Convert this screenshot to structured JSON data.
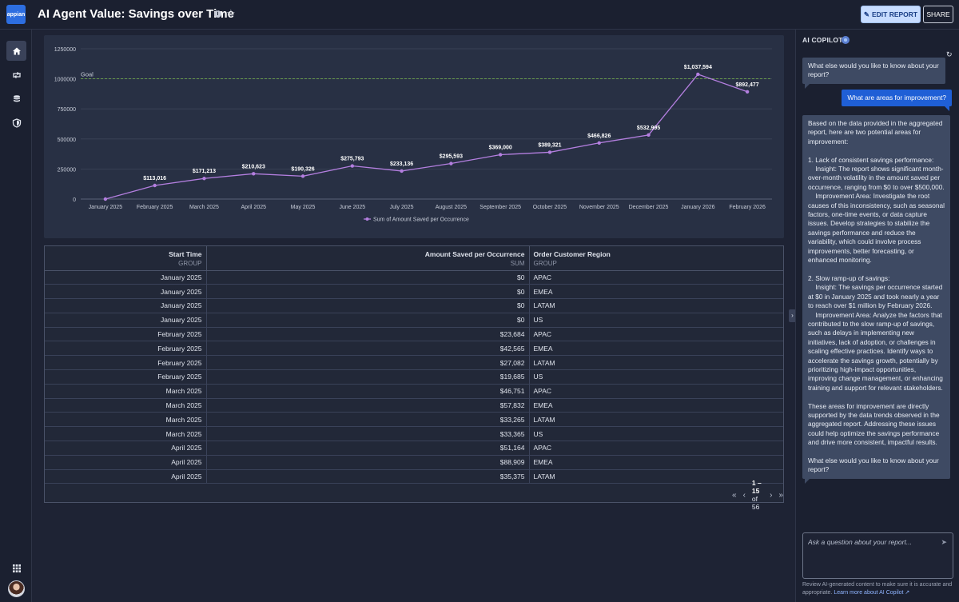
{
  "header": {
    "logo_text": "appian",
    "title": "AI Agent Value: Savings over Time",
    "edit_label": "EDIT REPORT",
    "share_label": "SHARE"
  },
  "nav": {
    "items": [
      "home-icon",
      "process-icon",
      "database-icon",
      "shield-icon"
    ],
    "apps_icon": "apps-grid-icon"
  },
  "chart_data": {
    "type": "line",
    "categories": [
      "January 2025",
      "February 2025",
      "March 2025",
      "April 2025",
      "May 2025",
      "June 2025",
      "July 2025",
      "August 2025",
      "September 2025",
      "October 2025",
      "November 2025",
      "December 2025",
      "January 2026",
      "February 2026"
    ],
    "series": [
      {
        "name": "Sum of Amount Saved per Occurrence",
        "values": [
          0,
          113016,
          171213,
          210623,
          190326,
          275793,
          233136,
          295593,
          369000,
          389321,
          466826,
          532995,
          1037594,
          892477
        ],
        "labels": [
          "",
          "$113,016",
          "$171,213",
          "$210,623",
          "$190,326",
          "$275,793",
          "$233,136",
          "$295,593",
          "$369,000",
          "$389,321",
          "$466,826",
          "$532,995",
          "$1,037,594",
          "$892,477"
        ],
        "color": "#b47fe0"
      }
    ],
    "yticks": [
      "0",
      "250000",
      "500000",
      "750000",
      "1000000",
      "1250000"
    ],
    "ylim": [
      0,
      1250000
    ],
    "goal": {
      "label": "Goal",
      "value": 1000000,
      "color": "#6fa84a"
    },
    "legend_position": "bottom"
  },
  "table": {
    "columns": [
      {
        "title": "Start Time",
        "sub": "GROUP"
      },
      {
        "title": "Amount Saved per Occurrence",
        "sub": "SUM"
      },
      {
        "title": "Order Customer Region",
        "sub": "GROUP"
      }
    ],
    "rows": [
      [
        "January 2025",
        "$0",
        "APAC"
      ],
      [
        "January 2025",
        "$0",
        "EMEA"
      ],
      [
        "January 2025",
        "$0",
        "LATAM"
      ],
      [
        "January 2025",
        "$0",
        "US"
      ],
      [
        "February 2025",
        "$23,684",
        "APAC"
      ],
      [
        "February 2025",
        "$42,565",
        "EMEA"
      ],
      [
        "February 2025",
        "$27,082",
        "LATAM"
      ],
      [
        "February 2025",
        "$19,685",
        "US"
      ],
      [
        "March 2025",
        "$46,751",
        "APAC"
      ],
      [
        "March 2025",
        "$57,832",
        "EMEA"
      ],
      [
        "March 2025",
        "$33,265",
        "LATAM"
      ],
      [
        "March 2025",
        "$33,365",
        "US"
      ],
      [
        "April 2025",
        "$51,164",
        "APAC"
      ],
      [
        "April 2025",
        "$88,909",
        "EMEA"
      ],
      [
        "April 2025",
        "$35,375",
        "LATAM"
      ]
    ],
    "pager": {
      "range": "1 – 15",
      "of": "of 56"
    }
  },
  "copilot": {
    "title": "AI COPILOT",
    "messages": [
      {
        "role": "ai",
        "text": "What else would you like to know about your report?"
      },
      {
        "role": "user",
        "text": "What are areas for improvement?"
      },
      {
        "role": "ai",
        "text": "Based on the data provided in the aggregated report, here are two potential areas for improvement:\n\n1. Lack of consistent savings performance:\n    Insight: The report shows significant month-over-month volatility in the amount saved per occurrence, ranging from $0 to over $500,000.\n    Improvement Area: Investigate the root causes of this inconsistency, such as seasonal factors, one-time events, or data capture issues. Develop strategies to stabilize the savings performance and reduce the variability, which could involve process improvements, better forecasting, or enhanced monitoring.\n\n2. Slow ramp-up of savings:\n    Insight: The savings per occurrence started at $0 in January 2025 and took nearly a year to reach over $1 million by February 2026.\n    Improvement Area: Analyze the factors that contributed to the slow ramp-up of savings, such as delays in implementing new initiatives, lack of adoption, or challenges in scaling effective practices. Identify ways to accelerate the savings growth, potentially by prioritizing high-impact opportunities, improving change management, or enhancing training and support for relevant stakeholders.\n\nThese areas for improvement are directly supported by the data trends observed in the aggregated report. Addressing these issues could help optimize the savings performance and drive more consistent, impactful results.\n\nWhat else would you like to know about your report?"
      }
    ],
    "ask_placeholder": "Ask a question about your report...",
    "disclaimer": "Review AI-generated content to make sure it is accurate and appropriate.",
    "learn_more": "Learn more about AI Copilot"
  }
}
